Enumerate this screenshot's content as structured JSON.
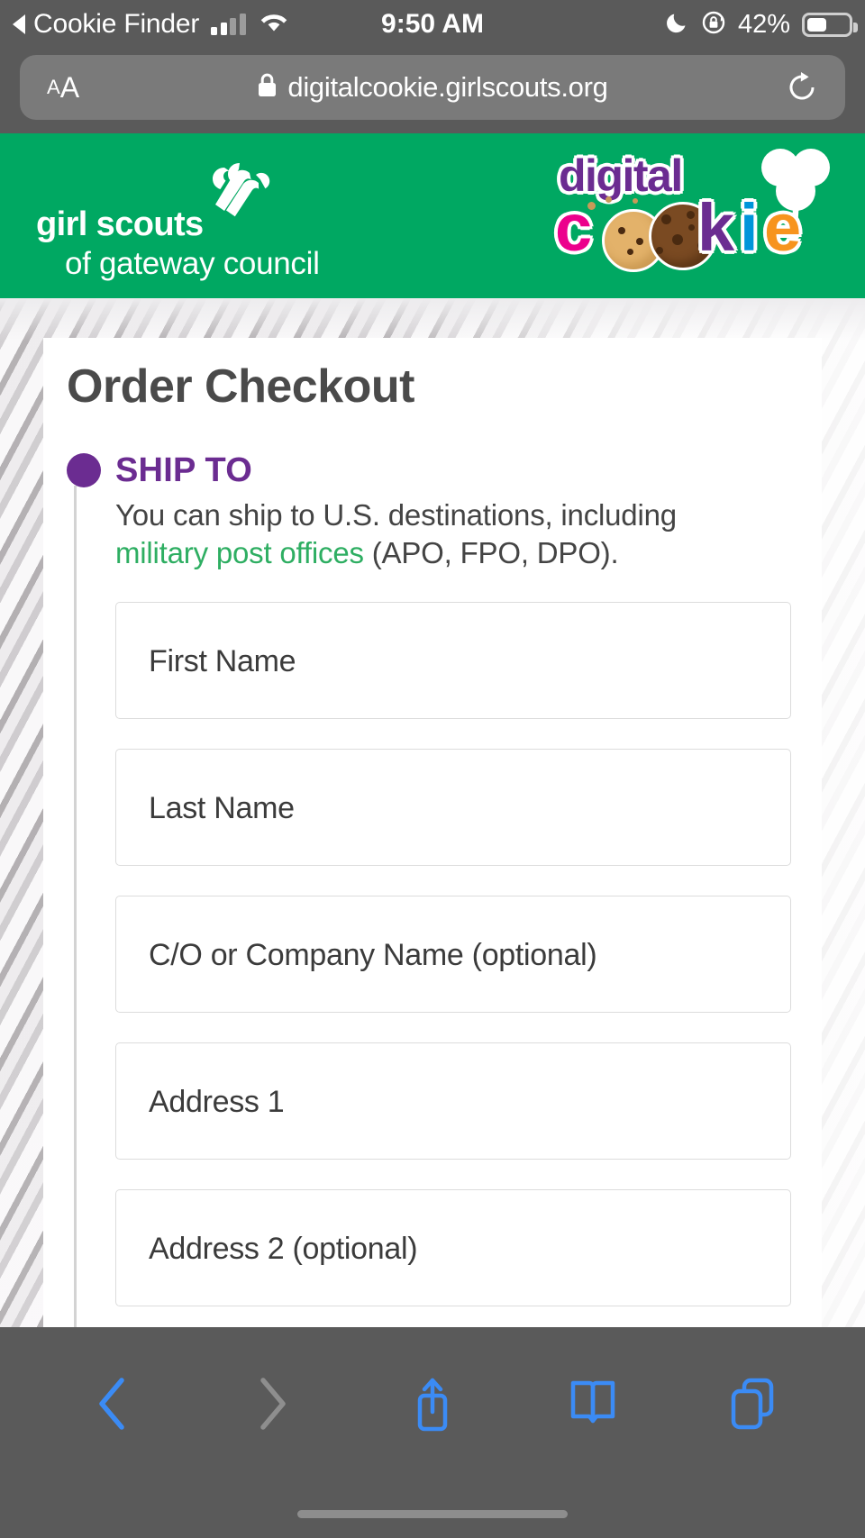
{
  "status_bar": {
    "back_app_label": "Cookie Finder",
    "back_arrow_icon": "back-triangle-icon",
    "signal_icon": "cellular-signal-icon",
    "wifi_icon": "wifi-icon",
    "time": "9:50 AM",
    "do_not_disturb_icon": "moon-icon",
    "rotation_lock_icon": "rotation-lock-icon",
    "battery_percent": "42%",
    "battery_icon": "battery-icon",
    "battery_level": 42
  },
  "browser": {
    "text_size_button": "AA",
    "lock_icon": "lock-icon",
    "url": "digitalcookie.girlscouts.org",
    "reload_icon": "reload-icon"
  },
  "brand_header": {
    "background_color": "#00a862",
    "council_logo": {
      "trefoil_icon": "girl-scouts-trefoil-icon",
      "line1": "girl scouts",
      "line2": "of gateway council"
    },
    "digital_cookie_logo": {
      "word_digital": "digital",
      "letter_c": "c",
      "letter_k": "k",
      "letter_i": "i",
      "letter_e": "e",
      "cookie_icon": "cookie-icon",
      "trefoil_icon": "trefoil-cloud-icon",
      "colors": {
        "digital": "#6b2c91",
        "c": "#ec008c",
        "k": "#6b2c91",
        "i": "#0095da",
        "e": "#f7941e"
      }
    }
  },
  "page": {
    "title": "Order Checkout",
    "step": {
      "heading": "SHIP TO",
      "accent_color": "#6b2c91",
      "description_before": "You can ship to U.S. destinations, including ",
      "description_link": "military post offices",
      "description_after": " (APO, FPO, DPO).",
      "link_color": "#2eae62"
    },
    "form_fields": [
      {
        "name": "first-name",
        "placeholder": "First Name",
        "value": ""
      },
      {
        "name": "last-name",
        "placeholder": "Last Name",
        "value": ""
      },
      {
        "name": "company-name",
        "placeholder": "C/O or Company Name (optional)",
        "value": ""
      },
      {
        "name": "address-1",
        "placeholder": "Address 1",
        "value": ""
      },
      {
        "name": "address-2",
        "placeholder": "Address 2 (optional)",
        "value": ""
      }
    ]
  },
  "bottom_toolbar": {
    "back_icon": "chevron-left-icon",
    "forward_icon": "chevron-right-icon",
    "share_icon": "share-icon",
    "bookmarks_icon": "book-icon",
    "tabs_icon": "tabs-icon",
    "back_enabled": true,
    "forward_enabled": false
  }
}
